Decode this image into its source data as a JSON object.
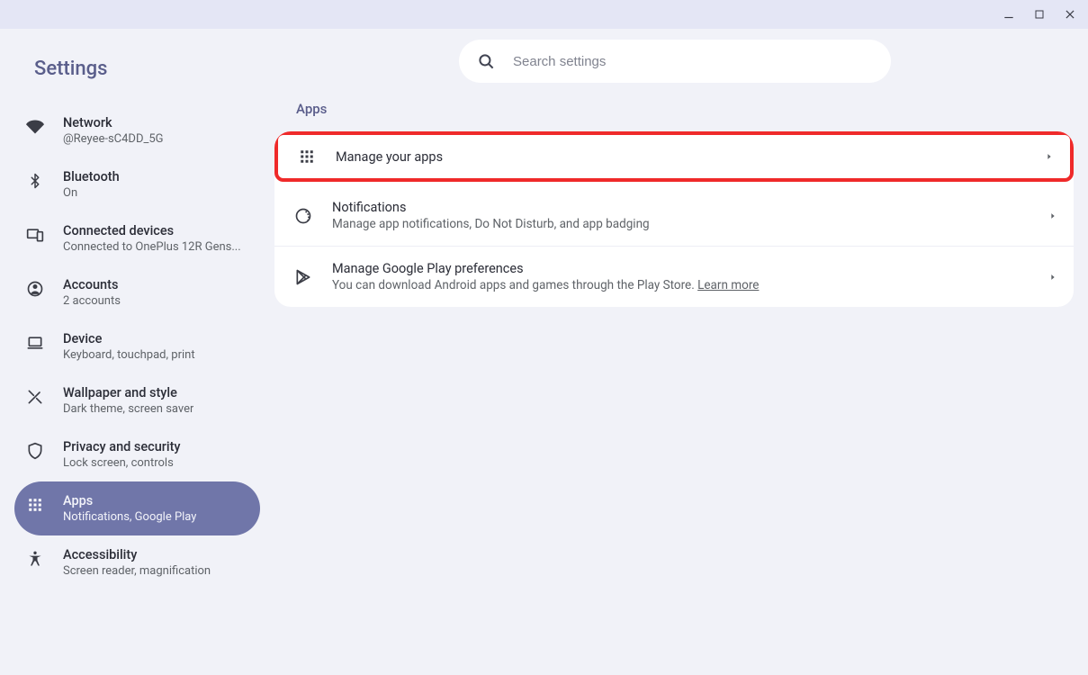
{
  "window": {
    "title": "Settings"
  },
  "search": {
    "placeholder": "Search settings"
  },
  "sidebar": {
    "items": [
      {
        "title": "Network",
        "sub": "@Reyee-sC4DD_5G"
      },
      {
        "title": "Bluetooth",
        "sub": "On"
      },
      {
        "title": "Connected devices",
        "sub": "Connected to OnePlus 12R Gens..."
      },
      {
        "title": "Accounts",
        "sub": "2 accounts"
      },
      {
        "title": "Device",
        "sub": "Keyboard, touchpad, print"
      },
      {
        "title": "Wallpaper and style",
        "sub": "Dark theme, screen saver"
      },
      {
        "title": "Privacy and security",
        "sub": "Lock screen, controls"
      },
      {
        "title": "Apps",
        "sub": "Notifications, Google Play"
      },
      {
        "title": "Accessibility",
        "sub": "Screen reader, magnification"
      }
    ]
  },
  "main": {
    "section_title": "Apps",
    "cards": [
      {
        "title": "Manage your apps",
        "sub": ""
      },
      {
        "title": "Notifications",
        "sub": "Manage app notifications, Do Not Disturb, and app badging"
      },
      {
        "title": "Manage Google Play preferences",
        "sub": "You can download Android apps and games through the Play Store. ",
        "link": "Learn more"
      }
    ]
  }
}
